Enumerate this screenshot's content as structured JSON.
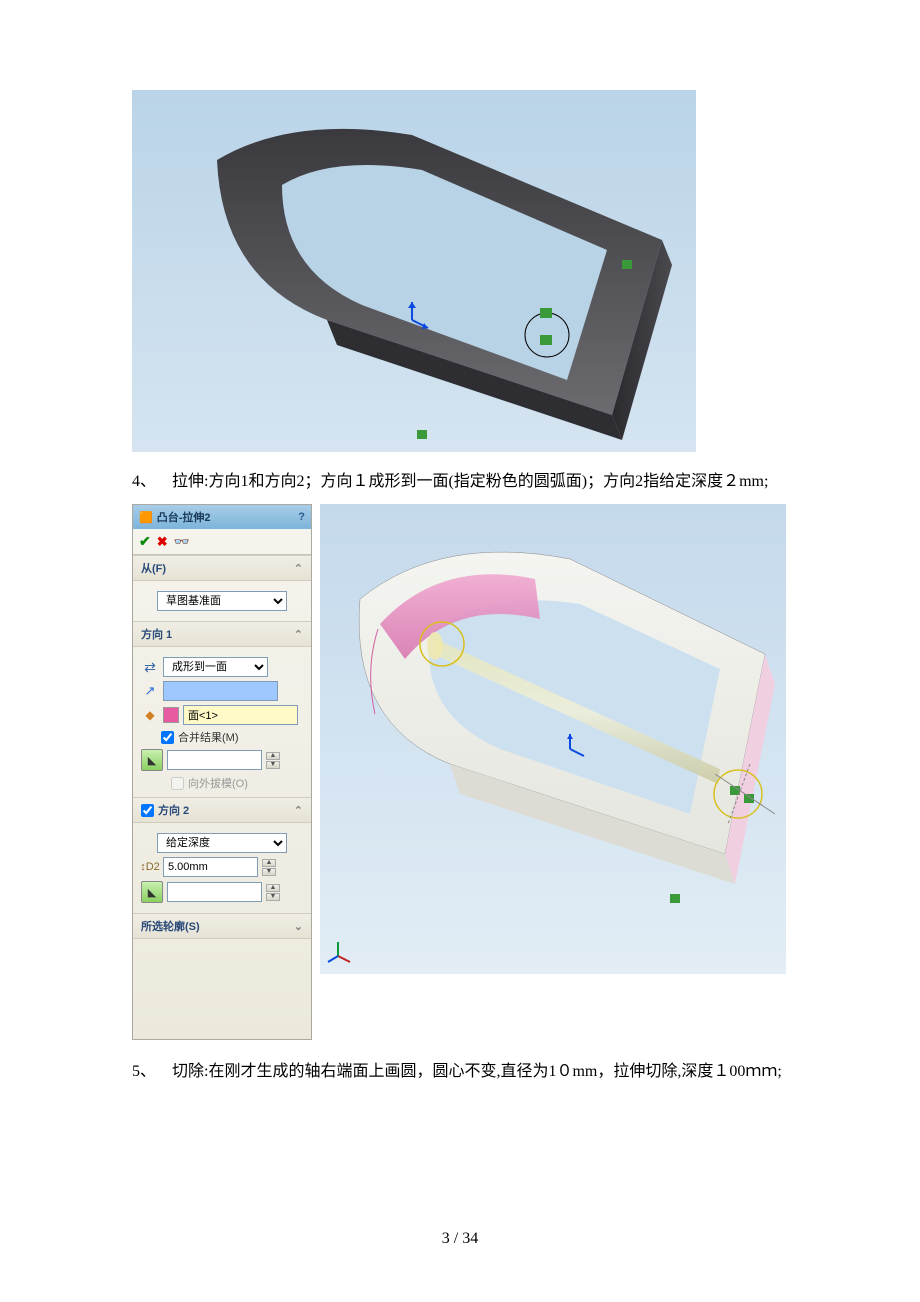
{
  "steps": {
    "s4": {
      "num": "4、",
      "text": "拉伸:方向1和方向2；方向１成形到一面(指定粉色的圆弧面)；方向2指给定深度２mm;"
    },
    "s5": {
      "num": "5、",
      "text": "切除:在刚才生成的轴右端面上画圆，圆心不变,直径为1０mm，拉伸切除,深度１00ｍｍ;"
    }
  },
  "panel": {
    "title": "凸台-拉伸2",
    "from_label": "从(F)",
    "from_select": "草图基准面",
    "dir1_label": "方向 1",
    "dir1_select": "成形到一面",
    "face_value": "面<1>",
    "merge_label": "合并结果(M)",
    "draft_label": "向外拔模(O)",
    "dir2_label": "方向 2",
    "dir2_select": "给定深度",
    "depth_value": "5.00mm",
    "contour_label": "所选轮廓(S)"
  },
  "footer": "3 / 34"
}
